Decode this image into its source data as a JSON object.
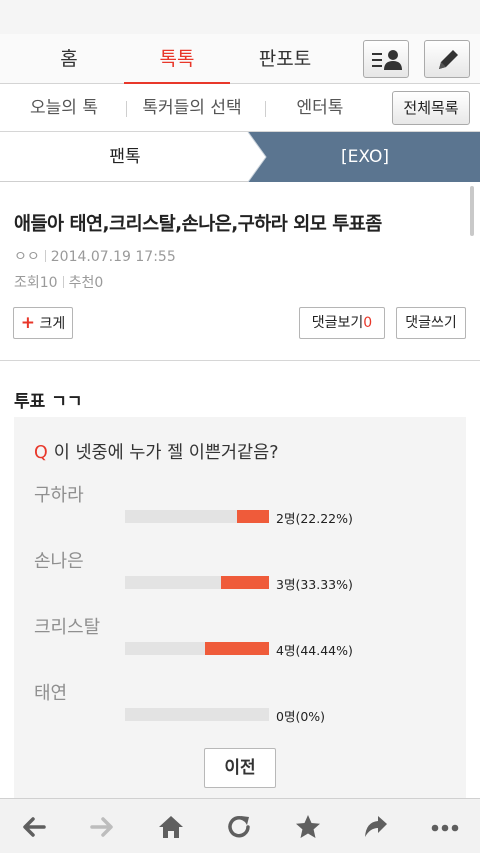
{
  "main_tabs": [
    {
      "label": "홈",
      "active": false
    },
    {
      "label": "톡톡",
      "active": true
    },
    {
      "label": "판포토",
      "active": false
    }
  ],
  "header_icons": {
    "list_icon": "user-list-icon",
    "write_icon": "pencil-icon"
  },
  "sub_nav": {
    "items": [
      "오늘의 톡",
      "톡커들의 선택",
      "엔터톡"
    ],
    "all_list_label": "전체목록"
  },
  "breadcrumb": {
    "left": "팬톡",
    "right": "[EXO]"
  },
  "post": {
    "title": "애들아 태연,크리스탈,손나은,구하라 외모 투표좀",
    "author": "ㅇㅇ",
    "datetime": "2014.07.19 17:55",
    "views_label": "조회",
    "views": "10",
    "recommend_label": "추천",
    "recommends": "0"
  },
  "actions": {
    "enlarge_plus": "+",
    "enlarge_label": "크게",
    "view_comments_label": "댓글보기",
    "comment_count": "0",
    "write_comment_label": "댓글쓰기"
  },
  "vote": {
    "heading": "투표 ㄱㄱ",
    "question_mark": "Q",
    "question": "이 넷중에 누가 젤 이쁜거같음?",
    "options": [
      {
        "name": "구하라",
        "fraction": 0.2222,
        "result": "2명(22.22%)"
      },
      {
        "name": "손나은",
        "fraction": 0.3333,
        "result": "3명(33.33%)"
      },
      {
        "name": "크리스탈",
        "fraction": 0.4444,
        "result": "4명(44.44%)"
      },
      {
        "name": "태연",
        "fraction": 0,
        "result": "0명(0%)"
      }
    ],
    "prev_label": "이전"
  },
  "colors": {
    "accent": "#e8372a",
    "bar_fill": "#ef5b3a",
    "crumb_bg": "#5b7590"
  },
  "bottom_nav": [
    "back-arrow-icon",
    "forward-arrow-icon",
    "home-icon",
    "refresh-icon",
    "star-icon",
    "share-icon",
    "more-icon"
  ]
}
